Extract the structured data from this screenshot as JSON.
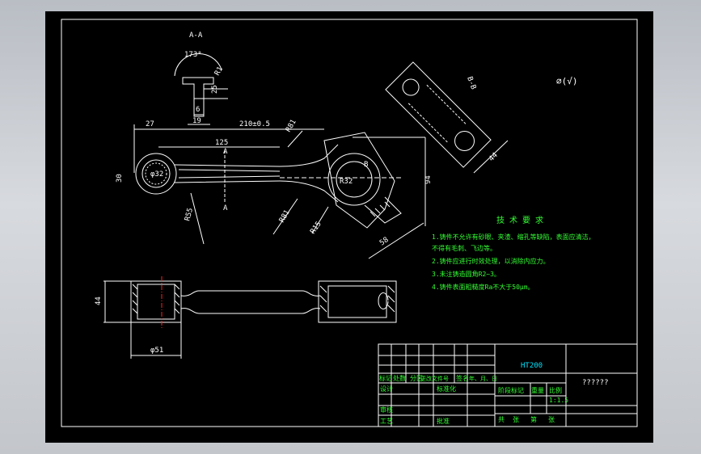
{
  "colors": {
    "paper": "#000000",
    "linework": "#ffffff",
    "dimension": "#00e5ff",
    "notes": "#33ff33",
    "centerline": "#ff2020"
  },
  "section_view": {
    "label": "A-A",
    "angle": "173°",
    "dims": [
      "R1",
      "25",
      "6",
      "19"
    ]
  },
  "main_view": {
    "dims": {
      "length": "210±0.5",
      "offset": "27",
      "inner": "125",
      "small_dia": "30",
      "r32": "R32",
      "r55": "R55",
      "r81a": "R81",
      "r81b": "R81",
      "r15": "R15",
      "h94": "94",
      "w58": "58",
      "small_hole": "φ32"
    },
    "section_marks": [
      "A",
      "A"
    ],
    "b_mark": "B"
  },
  "detail_view": {
    "label": "B-B",
    "dim": "44"
  },
  "roughness_symbol": "∅(√)",
  "tech_requirements": {
    "title": "技 术 要 求",
    "lines": [
      "1.铸件不允许有砂眼、夹渣、缩孔等缺陷，表面应清洁，",
      "   不得有毛刺、飞边等。",
      "2.铸件应进行时效处理，以消除内应力。",
      "3.未注铸造圆角R2~3。",
      "4.铸件表面粗糙度Ra不大于50μm。"
    ]
  },
  "bottom_view": {
    "height": "44",
    "width": "φ51"
  },
  "title_block": {
    "material": "HT200",
    "part_name": "??????",
    "header_row": [
      "标记",
      "处数",
      "分区",
      "更改文件号",
      "签名",
      "年、月、日"
    ],
    "labels": [
      "设计",
      "标准化",
      "审核",
      "工艺",
      "批准",
      "阶段标记",
      "重量",
      "比例",
      "共",
      "张",
      "第",
      "张"
    ],
    "scale": "1:1.5"
  }
}
